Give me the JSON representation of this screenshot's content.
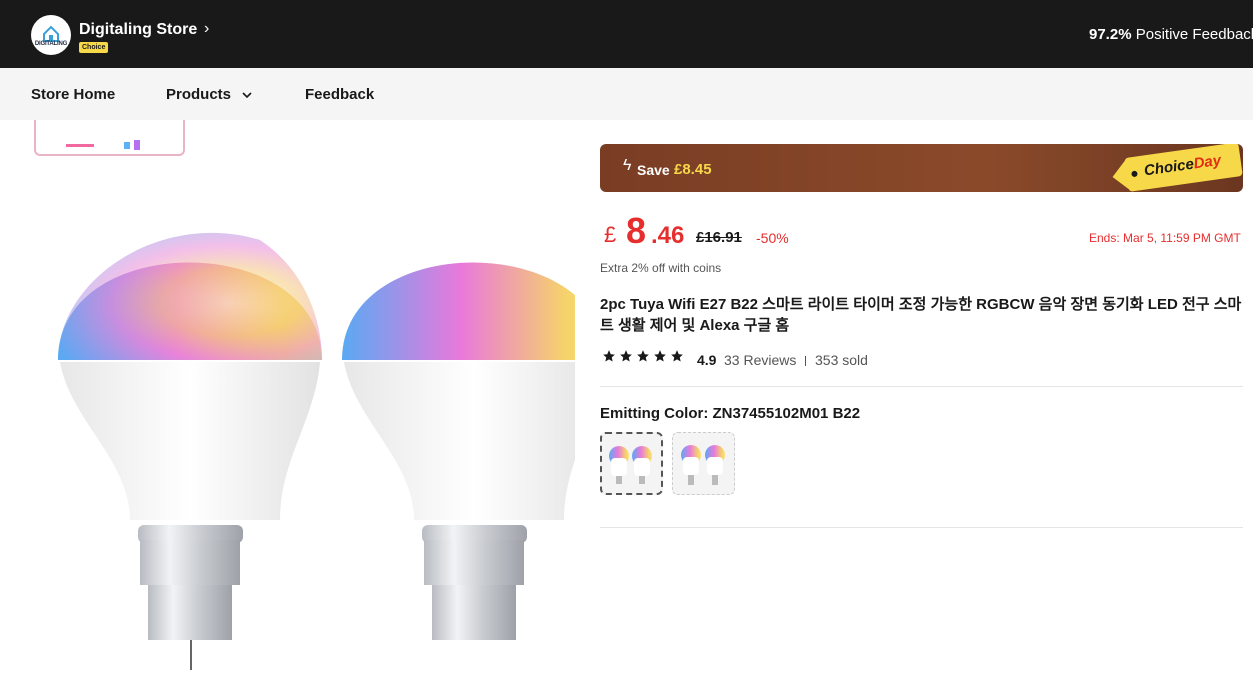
{
  "header": {
    "logo_text": "DIGITALING",
    "store_name": "Digitaling Store",
    "choice_badge": "Choice",
    "positive_feedback_pct": "97.2%",
    "positive_feedback_label": "Positive Feedback"
  },
  "nav": {
    "items": [
      {
        "label": "Store Home"
      },
      {
        "label": "Products"
      },
      {
        "label": "Feedback"
      }
    ]
  },
  "promo": {
    "save_label": "Save",
    "save_amount": "£8.45",
    "choiceday_a": "Choice",
    "choiceday_b": "Day"
  },
  "price": {
    "currency": "£",
    "integer": "8",
    "decimal": ".46",
    "original": "£16.91",
    "discount": "-50%",
    "ends": "Ends: Mar 5, 11:59 PM GMT",
    "extra": "Extra 2% off with coins"
  },
  "product": {
    "title": "2pc Tuya Wifi E27 B22 스마트 라이트 타이머 조정 가능한 RGBCW 음악 장면 동기화 LED 전구 스마트 생활 제어 및 Alexa 구글 홈",
    "rating": "4.9",
    "stars": 5,
    "reviews": "33 Reviews",
    "sold": "353 sold"
  },
  "variants": {
    "label": "Emitting Color: ZN37455102M01 B22",
    "options": [
      {
        "name": "ZN37455102M01 B22",
        "selected": true
      },
      {
        "name": "E27",
        "selected": false
      }
    ]
  },
  "colors": {
    "accent": "#e72e2e",
    "topbar": "#191919",
    "choice_yellow": "#f7d848",
    "banner_brown": "#7a3d24"
  }
}
